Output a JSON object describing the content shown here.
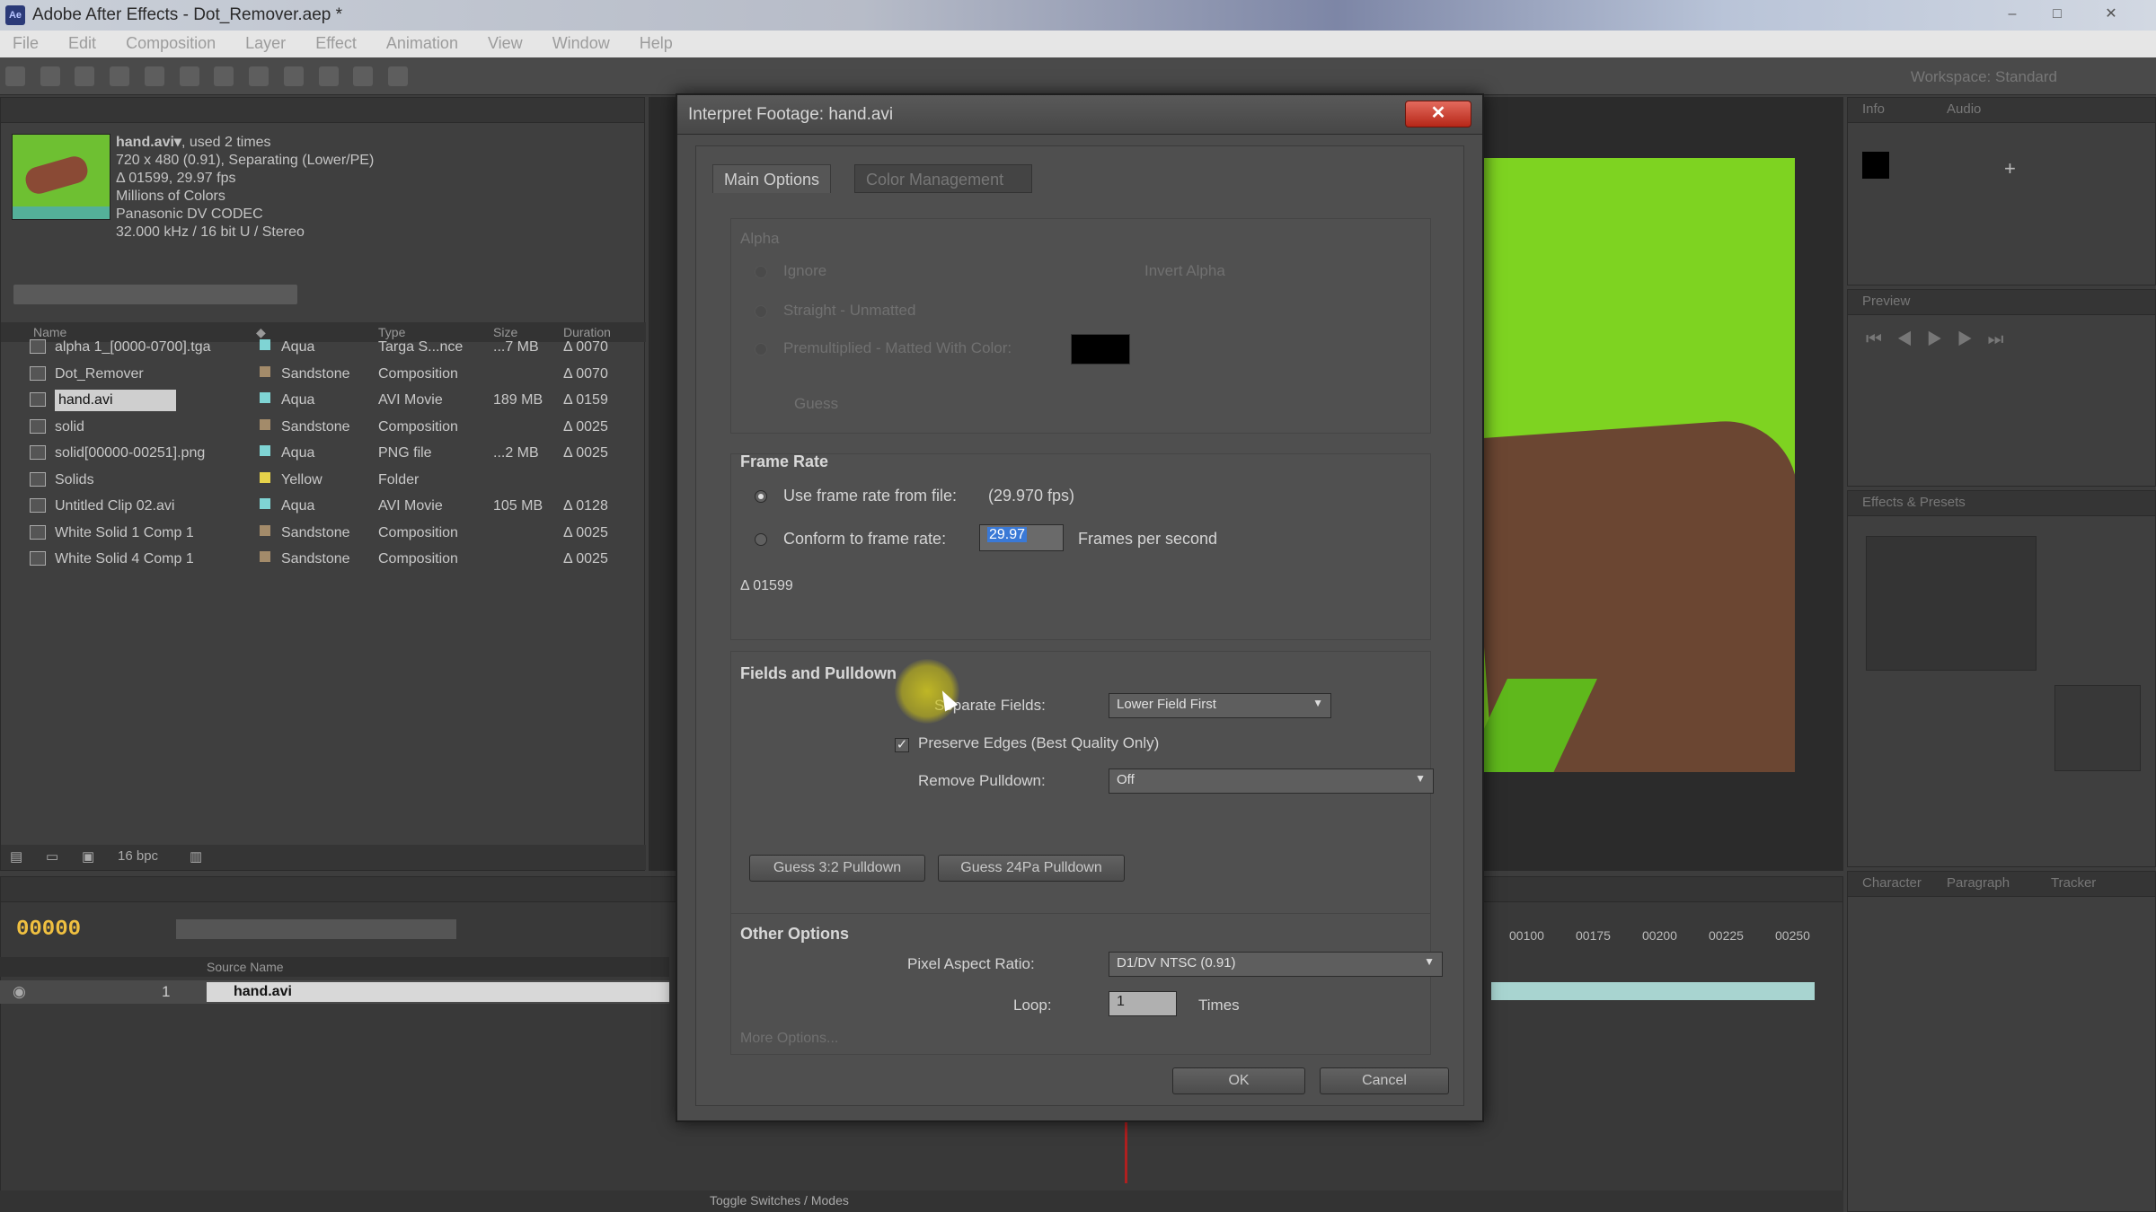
{
  "window": {
    "title": "Adobe After Effects - Dot_Remover.aep *",
    "icon": "ae-app-icon",
    "minimize": "–",
    "maximize": "□",
    "close": "✕"
  },
  "menu": [
    "File",
    "Edit",
    "Composition",
    "Layer",
    "Effect",
    "Animation",
    "View",
    "Window",
    "Help"
  ],
  "toolbar": {
    "workspace_label": "Workspace:   Standard"
  },
  "project": {
    "footage_name": "hand.avi▾",
    "footage_used": ", used 2 times",
    "info_lines": [
      "720 x 480 (0.91), Separating (Lower/PE)",
      "Δ 01599, 29.97 fps",
      "Millions of Colors",
      "Panasonic DV CODEC",
      "32.000 kHz / 16 bit U / Stereo"
    ],
    "columns": [
      "Name",
      "Type",
      "Size",
      "Duration"
    ],
    "rows": [
      {
        "name": "alpha 1_[0000-0700].tga",
        "label": "Aqua",
        "type": "Targa S...nce",
        "size": "...7 MB",
        "duration": "Δ 0070",
        "label_color": "#7fd4d4"
      },
      {
        "name": "Dot_Remover",
        "label": "Sandstone",
        "type": "Composition",
        "size": "",
        "duration": "Δ 0070",
        "label_color": "#a38b6a"
      },
      {
        "name": "hand.avi",
        "label": "Aqua",
        "type": "AVI Movie",
        "size": "189 MB",
        "duration": "Δ 0159",
        "label_color": "#7fd4d4"
      },
      {
        "name": "solid",
        "label": "Sandstone",
        "type": "Composition",
        "size": "",
        "duration": "Δ 0025",
        "label_color": "#a38b6a"
      },
      {
        "name": "solid[00000-00251].png",
        "label": "Aqua",
        "type": "PNG file",
        "size": "...2 MB",
        "duration": "Δ 0025",
        "label_color": "#7fd4d4"
      },
      {
        "name": "Solids",
        "label": "Yellow",
        "type": "Folder",
        "size": "",
        "duration": "",
        "label_color": "#e6d24a"
      },
      {
        "name": "Untitled Clip 02.avi",
        "label": "Aqua",
        "type": "AVI Movie",
        "size": "105 MB",
        "duration": "Δ 0128",
        "label_color": "#7fd4d4"
      },
      {
        "name": "White Solid 1 Comp 1",
        "label": "Sandstone",
        "type": "Composition",
        "size": "",
        "duration": "Δ 0025",
        "label_color": "#a38b6a"
      },
      {
        "name": "White Solid 4 Comp 1",
        "label": "Sandstone",
        "type": "Composition",
        "size": "",
        "duration": "Δ 0025",
        "label_color": "#a38b6a"
      }
    ],
    "footer_bpc": "16 bpc"
  },
  "timeline": {
    "timecode": "00000",
    "source_name_header": "Source Name",
    "layer_name": "hand.avi",
    "layer_index": "1",
    "ruler": [
      "00100",
      "00175",
      "00200",
      "00225",
      "00250"
    ],
    "footer": "Toggle Switches / Modes"
  },
  "dialog": {
    "title": "Interpret Footage: hand.avi",
    "close_glyph": "✕",
    "tabs": [
      "Main Options",
      "Color Management"
    ],
    "alpha": {
      "title": "Alpha",
      "options": [
        "Ignore",
        "Straight - Unmatted",
        "Premultiplied - Matted With Color:"
      ],
      "invert": "Invert Alpha",
      "guess": "Guess",
      "matte_color": "#000000"
    },
    "frame_rate": {
      "title": "Frame Rate",
      "use_file": "Use frame rate from file:",
      "file_rate": "(29.970 fps)",
      "conform": "Conform to frame rate:",
      "conform_value": "29.97",
      "fps_label": "Frames per second",
      "duration": "Δ 01599"
    },
    "fields": {
      "title": "Fields and Pulldown",
      "separate_label": "Separate Fields:",
      "separate_value": "Lower Field First",
      "preserve_label": "Preserve Edges (Best Quality Only)",
      "preserve_check": "✓",
      "pulldown_label": "Remove Pulldown:",
      "pulldown_value": "Off",
      "guess32": "Guess 3:2 Pulldown",
      "guess24": "Guess 24Pa Pulldown"
    },
    "other": {
      "title": "Other Options",
      "par_label": "Pixel Aspect Ratio:",
      "par_value": "D1/DV NTSC (0.91)",
      "loop_label": "Loop:",
      "loop_value": "1",
      "times_label": "Times",
      "more": "More Options..."
    },
    "ok": "OK",
    "cancel": "Cancel"
  },
  "right_panels": {
    "info_tab": "Info",
    "audio_tab": "Audio",
    "preview_tab": "Preview",
    "effects_tab": "Effects & Presets",
    "character_tab": "Character",
    "paragraph_tab": "Paragraph",
    "tracker_tab": "Tracker"
  },
  "colors": {
    "accent_selection": "#3a79d6",
    "close_red": "#c9362a",
    "green_screen": "#7ed321"
  }
}
